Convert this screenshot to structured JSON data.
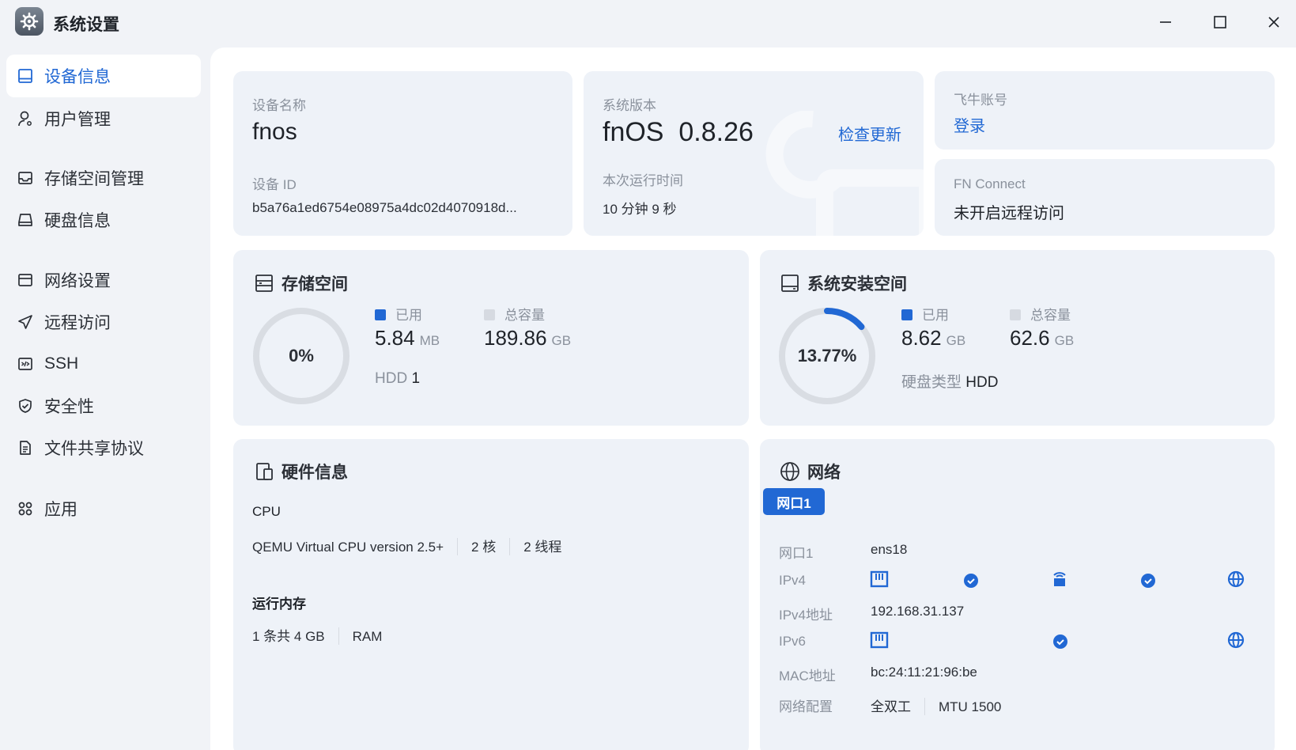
{
  "window": {
    "title": "系统设置"
  },
  "sidebar": {
    "items": [
      {
        "label": "设备信息",
        "icon": "monitor-icon",
        "active": true
      },
      {
        "label": "用户管理",
        "icon": "user-icon"
      },
      {
        "label": "存储空间管理",
        "icon": "storage-icon"
      },
      {
        "label": "硬盘信息",
        "icon": "disk-icon"
      },
      {
        "label": "网络设置",
        "icon": "network-icon"
      },
      {
        "label": "远程访问",
        "icon": "send-icon"
      },
      {
        "label": "SSH",
        "icon": "terminal-icon"
      },
      {
        "label": "安全性",
        "icon": "shield-icon"
      },
      {
        "label": "文件共享协议",
        "icon": "document-icon"
      },
      {
        "label": "应用",
        "icon": "apps-icon"
      }
    ]
  },
  "device": {
    "name_label": "设备名称",
    "name": "fnos",
    "id_label": "设备 ID",
    "id": "b5a76a1ed6754e08975a4dc02d4070918d..."
  },
  "system": {
    "version_label": "系统版本",
    "os": "fnOS",
    "version": "0.8.26",
    "check_update": "检查更新",
    "uptime_label": "本次运行时间",
    "uptime": "10 分钟 9 秒"
  },
  "account": {
    "label": "飞牛账号",
    "login": "登录"
  },
  "fn_connect": {
    "label": "FN Connect",
    "status": "未开启远程访问"
  },
  "storage": {
    "title": "存储空间",
    "percent_text": "0%",
    "percent": 0,
    "used_label": "已用",
    "used_value": "5.84",
    "used_unit": "MB",
    "total_label": "总容量",
    "total_value": "189.86",
    "total_unit": "GB",
    "hdd_label": "HDD",
    "hdd_count": "1"
  },
  "system_space": {
    "title": "系统安装空间",
    "percent_text": "13.77%",
    "percent": 13.77,
    "used_label": "已用",
    "used_value": "8.62",
    "used_unit": "GB",
    "total_label": "总容量",
    "total_value": "62.6",
    "total_unit": "GB",
    "disk_type_label": "硬盘类型",
    "disk_type": "HDD"
  },
  "hardware": {
    "title": "硬件信息",
    "cpu_label": "CPU",
    "cpu_model": "QEMU Virtual CPU version 2.5+",
    "cpu_cores": "2 核",
    "cpu_threads": "2 线程",
    "mem_label": "运行内存",
    "mem_amount": "1 条共 4 GB",
    "mem_type": "RAM"
  },
  "network": {
    "title": "网络",
    "port_tab": "网口1",
    "rows": {
      "port_label": "网口1",
      "port_value": "ens18",
      "ipv4_label": "IPv4",
      "ipv4_addr_label": "IPv4地址",
      "ipv4_addr": "192.168.31.137",
      "ipv6_label": "IPv6",
      "mac_label": "MAC地址",
      "mac": "bc:24:11:21:96:be",
      "config_label": "网络配置",
      "duplex": "全双工",
      "mtu": "MTU 1500"
    }
  },
  "colors": {
    "accent": "#2168d4",
    "ring_track": "#d9dde3",
    "card_bg": "#eef2f8",
    "legend_total": "#d6dae1"
  }
}
